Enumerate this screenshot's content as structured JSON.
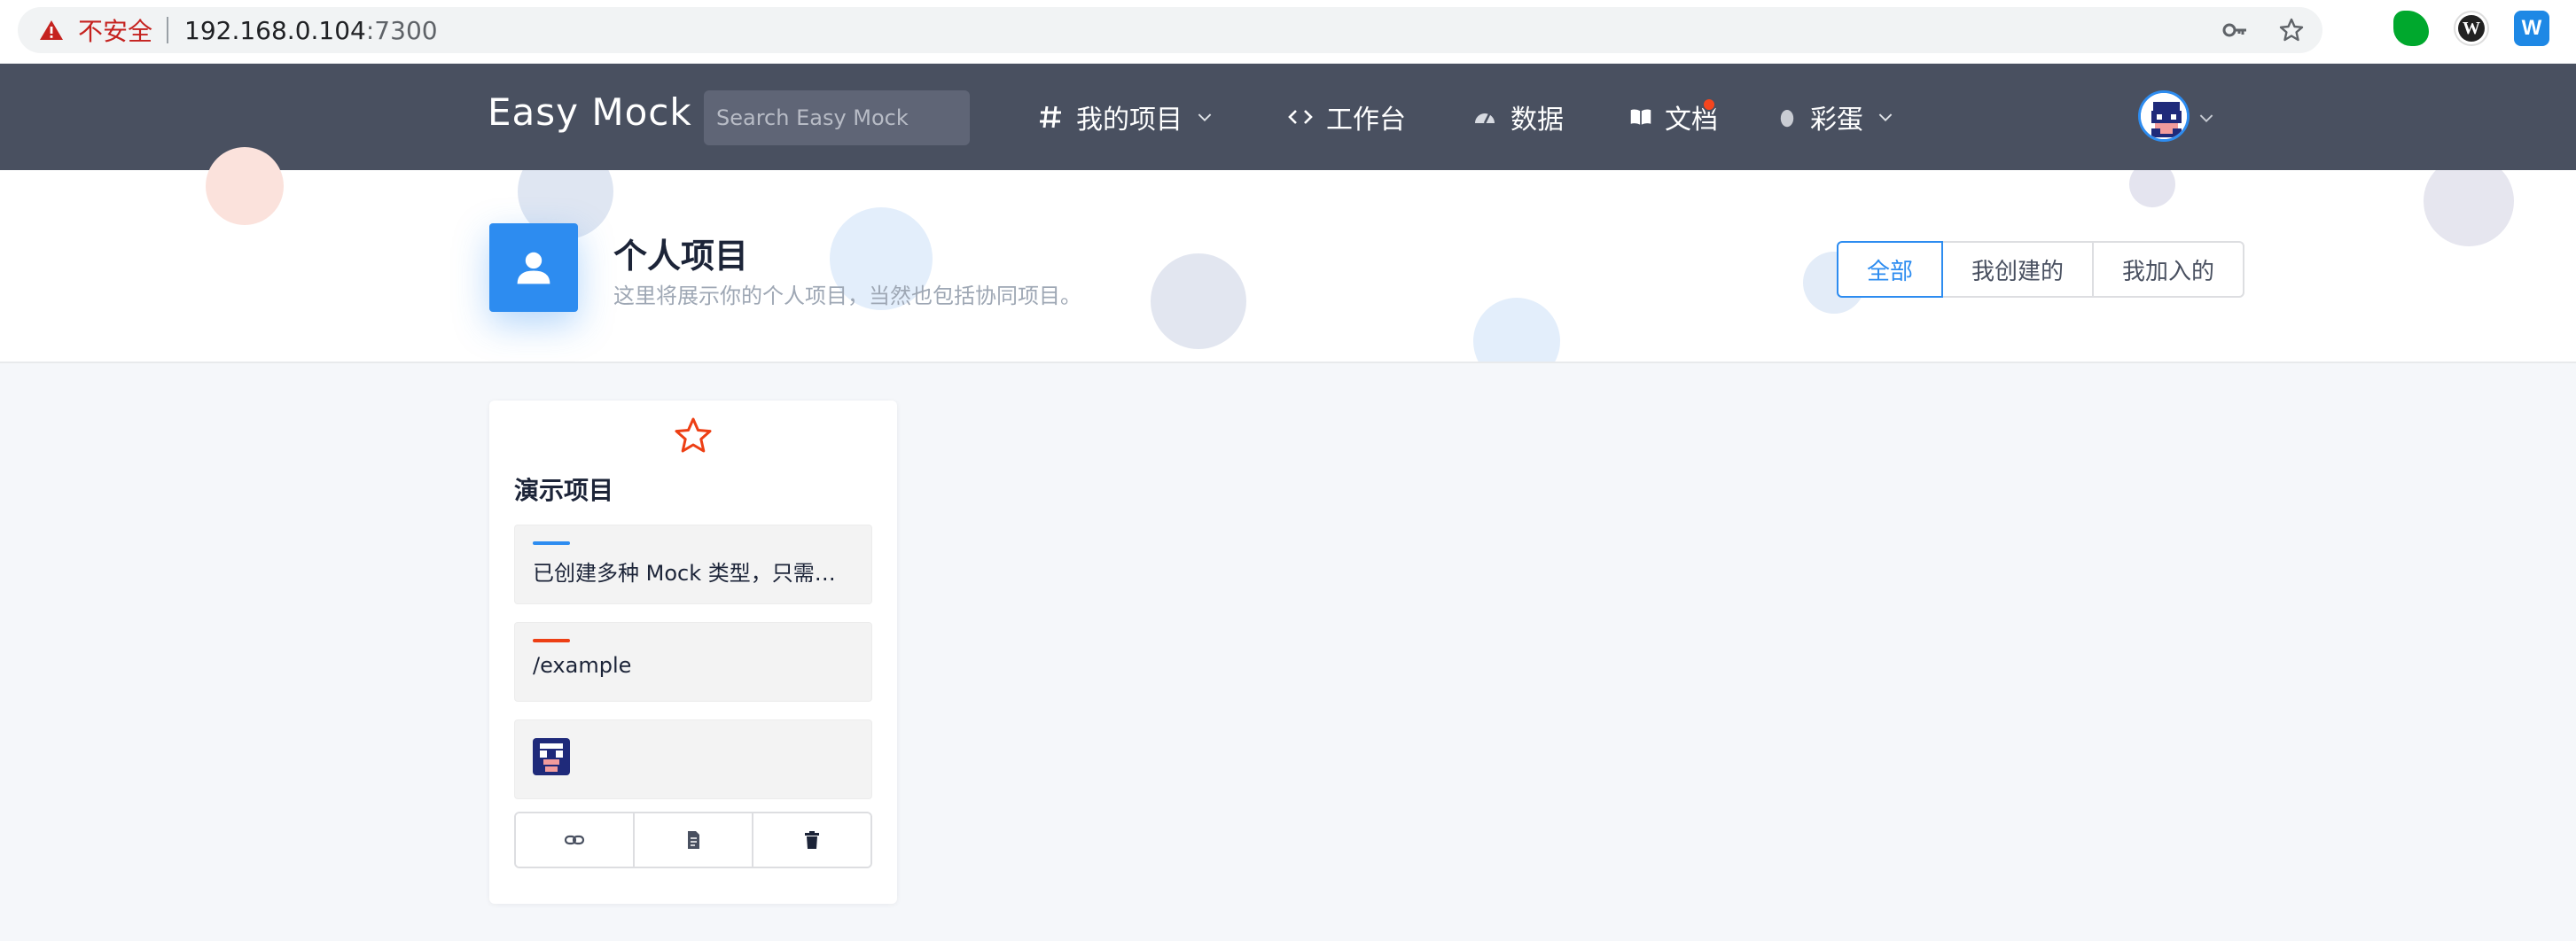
{
  "browser": {
    "insecure_label": "不安全",
    "url_host": "192.168.0.104",
    "url_port": ":7300"
  },
  "nav": {
    "brand": "Easy Mock",
    "search_placeholder": "Search Easy Mock",
    "items": [
      {
        "label": "我的项目",
        "icon": "hash-icon",
        "has_dropdown": true
      },
      {
        "label": "工作台",
        "icon": "code-icon",
        "has_dropdown": false
      },
      {
        "label": "数据",
        "icon": "dashboard-icon",
        "has_dropdown": false
      },
      {
        "label": "文档",
        "icon": "book-icon",
        "has_dropdown": false,
        "has_badge": true
      },
      {
        "label": "彩蛋",
        "icon": "egg-icon",
        "has_dropdown": true
      }
    ],
    "badge_color": "#f5451e"
  },
  "header": {
    "title": "个人项目",
    "subtitle": "这里将展示你的个人项目，当然也包括协同项目。",
    "filters": [
      {
        "label": "全部",
        "active": true
      },
      {
        "label": "我创建的",
        "active": false
      },
      {
        "label": "我加入的",
        "active": false
      }
    ]
  },
  "card": {
    "title": "演示项目",
    "description": "已创建多种 Mock 类型，只需点击预览便可查看效果。",
    "url": "/example",
    "accent_blue": "#2d8cf0",
    "accent_red": "#ed3f14"
  },
  "colors": {
    "nav_bg": "#495060",
    "primary": "#2d8cf0",
    "page_bg": "#f5f7fa"
  }
}
